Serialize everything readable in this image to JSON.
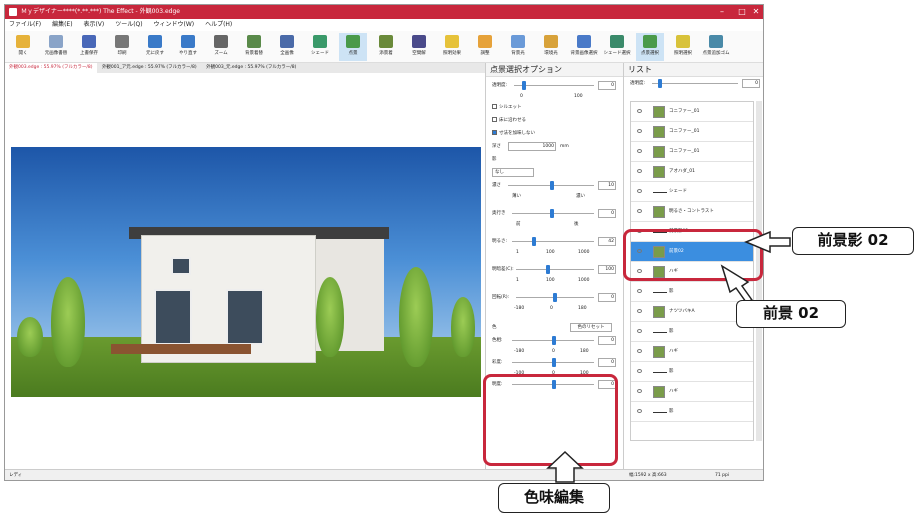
{
  "window": {
    "title": "Ｍｙデザイナー****(*.**.***) The Effect - 外観003.edge",
    "status_left": "レディ",
    "status_mid": "幅:1592 x 高:663",
    "status_right": "71 ppi"
  },
  "menu": [
    "ファイル(F)",
    "編集(E)",
    "表示(V)",
    "ツール(Q)",
    "ウィンドウ(W)",
    "ヘルプ(H)"
  ],
  "toolbar": [
    {
      "label": "開く",
      "color": "#e6b23a"
    },
    {
      "label": "元画像書替",
      "color": "#8aa4c8"
    },
    {
      "label": "上書保存",
      "color": "#4968b8"
    },
    {
      "label": "印刷",
      "color": "#777777"
    },
    {
      "label": "元に戻す",
      "color": "#3a7ac8"
    },
    {
      "label": "やり直す",
      "color": "#3a7ac8"
    },
    {
      "label": "ズーム",
      "color": "#666666"
    },
    {
      "label": "背景着替",
      "color": "#5a8a4a"
    },
    {
      "label": "全画像",
      "color": "#4a6aa8"
    },
    {
      "label": "シェード",
      "color": "#3a9a6a"
    },
    {
      "label": "点景",
      "color": "#4a9a4a"
    },
    {
      "label": "添景着",
      "color": "#6a8a3a"
    },
    {
      "label": "空間解",
      "color": "#4a4a8a"
    },
    {
      "label": "照明効果",
      "color": "#e6c23a"
    },
    {
      "label": "調整",
      "color": "#e6a23a"
    },
    {
      "label": "背景光",
      "color": "#6a9ad8"
    },
    {
      "label": "環境光",
      "color": "#d8a23a"
    },
    {
      "label": "背景画像選択",
      "color": "#4a7ac8"
    },
    {
      "label": "シェード選択",
      "color": "#3a8a6a"
    },
    {
      "label": "点景選択",
      "color": "#4a9a4a"
    },
    {
      "label": "照明選択",
      "color": "#d8c23a"
    },
    {
      "label": "点景追加ゴム",
      "color": "#4a8aa8"
    }
  ],
  "tabs": [
    "外観003.edge : 55.97% (フルカラー/8)",
    "外観001_ア元.edge : 55.97% (フルカラー/8)",
    "外観003_元.edge : 55.97% (フルカラー/8)"
  ],
  "option_panel": {
    "title": "点景選択オプション",
    "transparency_label": "透明度:",
    "transparency_value": "0",
    "scale_min": "0",
    "scale_max": "100",
    "silhouette": "シルエット",
    "fit_floor": "床に沿わせる",
    "keep_size": "寸法を加味しない",
    "depth_label": "深さ",
    "depth_value": "1000",
    "depth_unit": "mm",
    "shadow_label": "影",
    "shadow_select": "なし",
    "density_label": "濃さ",
    "density_value": "10",
    "density_min": "薄い",
    "density_max": "濃い",
    "depth2_label": "奥行き",
    "depth2_value": "0",
    "depth2_min": "前",
    "depth2_max": "後",
    "brightness_label": "明るさ:",
    "brightness_value": "42",
    "brightness_ticks": [
      "1",
      "100",
      "1000"
    ],
    "contrast_label": "明暗差(C):",
    "contrast_value": "100",
    "contrast_ticks": [
      "1",
      "100",
      "1000"
    ],
    "rotate_label": "回転(R):",
    "rotate_value": "0",
    "rotate_ticks": [
      "-180",
      "0",
      "180"
    ],
    "color_label": "色",
    "color_reset": "色のリセット",
    "hue_label": "色相:",
    "hue_value": "0",
    "hue_ticks": [
      "-180",
      "0",
      "180"
    ],
    "saturation_label": "彩度:",
    "saturation_value": "0",
    "saturation_ticks": [
      "-100",
      "0",
      "100"
    ],
    "lightness_label": "明度:",
    "lightness_value": "0"
  },
  "list_panel": {
    "title": "リスト",
    "transparency_label": "透明度:",
    "transparency_value": "0",
    "items": [
      {
        "label": "コニファー_01",
        "kind": "thumb"
      },
      {
        "label": "コニファー_01",
        "kind": "thumb"
      },
      {
        "label": "コニファー_01",
        "kind": "thumb"
      },
      {
        "label": "アオハダ_01",
        "kind": "thumb"
      },
      {
        "label": "シェード",
        "kind": "line"
      },
      {
        "label": "明るさ・コントラスト",
        "kind": "thumb"
      },
      {
        "label": "前景影02",
        "kind": "line"
      },
      {
        "label": "前景02",
        "kind": "thumb",
        "selected": true
      },
      {
        "label": "ハギ",
        "kind": "thumb"
      },
      {
        "label": "影",
        "kind": "line"
      },
      {
        "label": "ナツツバキA",
        "kind": "thumb"
      },
      {
        "label": "影",
        "kind": "line"
      },
      {
        "label": "ハギ",
        "kind": "thumb"
      },
      {
        "label": "影",
        "kind": "line"
      },
      {
        "label": "ハギ",
        "kind": "thumb"
      },
      {
        "label": "影",
        "kind": "line"
      }
    ]
  },
  "callouts": {
    "shadow": "前景影 02",
    "foreground": "前景 02",
    "hue_edit": "色味編集"
  },
  "colors": {
    "accent_red": "#c8273c",
    "selection_blue": "#3b8ee0"
  }
}
